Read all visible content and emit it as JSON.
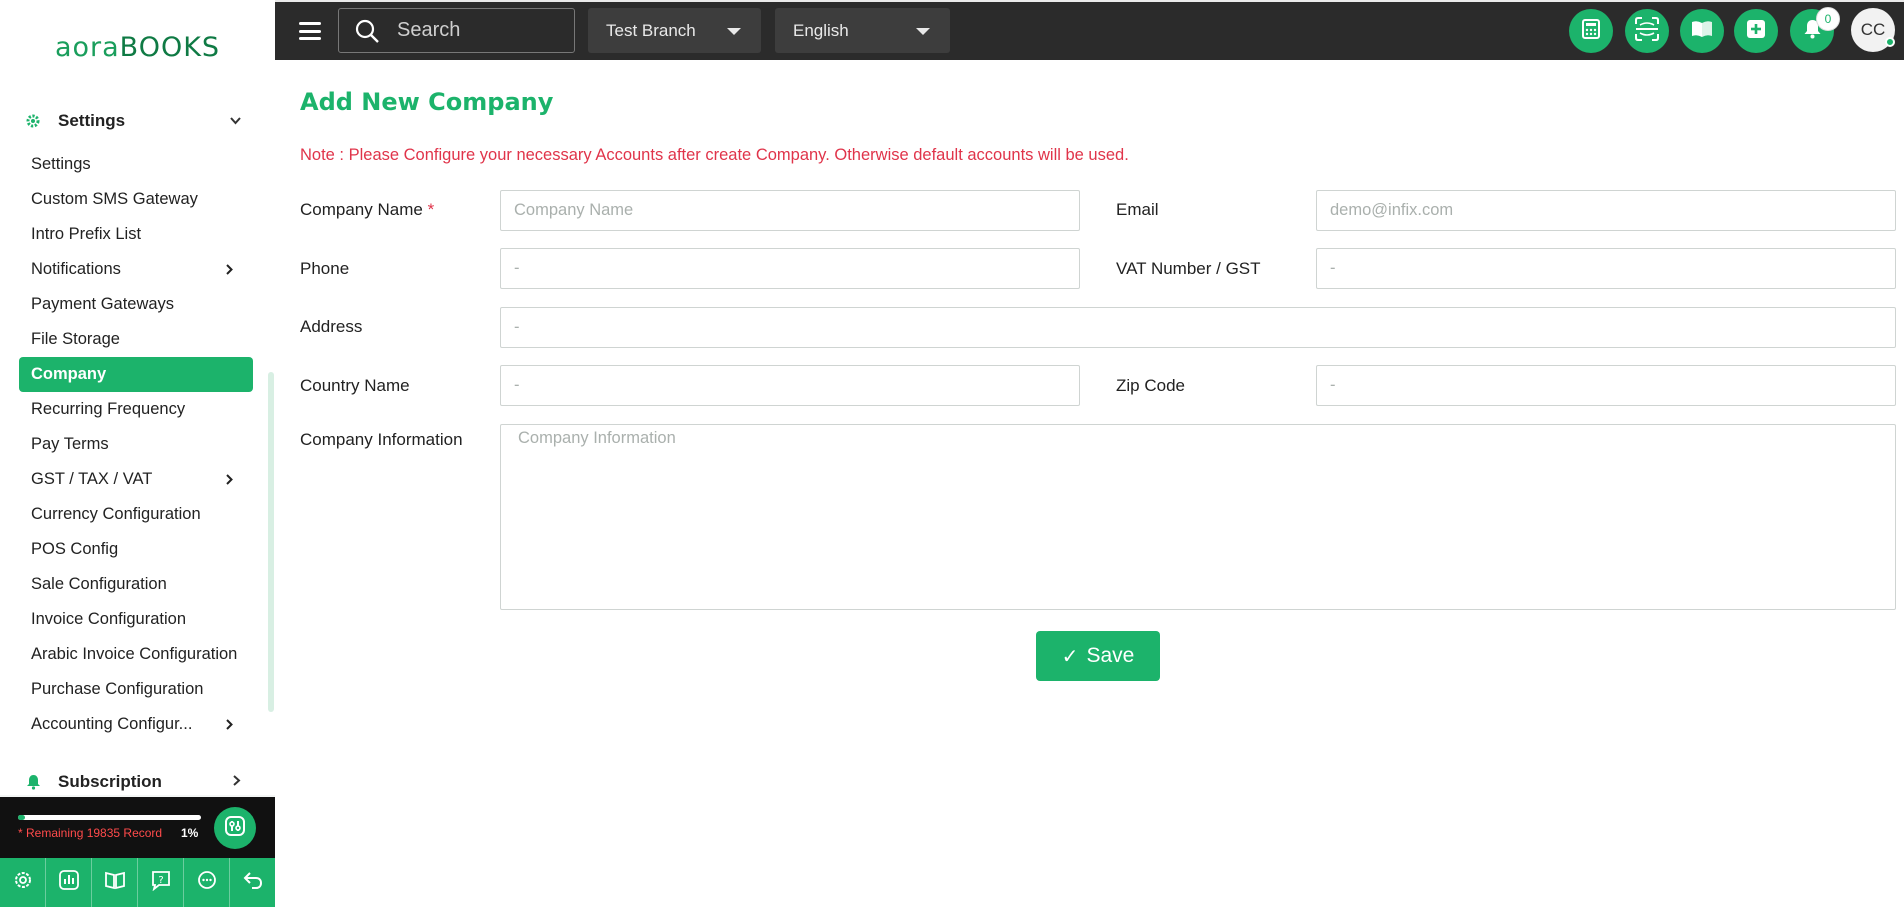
{
  "brand": {
    "logo_part1": "aora",
    "logo_part2": "BOOKS"
  },
  "header": {
    "search_placeholder": "Search",
    "branch": "Test Branch",
    "language": "English",
    "notification_count": "0",
    "avatar_initials": "CC",
    "buttons": [
      "calculator-icon",
      "scan-icon",
      "book-icon",
      "add-icon",
      "bell-icon"
    ]
  },
  "sidebar": {
    "section_title": "Settings",
    "items": [
      {
        "label": "Settings",
        "has_submenu": false,
        "active": false
      },
      {
        "label": "Custom SMS Gateway",
        "has_submenu": false,
        "active": false
      },
      {
        "label": "Intro Prefix List",
        "has_submenu": false,
        "active": false
      },
      {
        "label": "Notifications",
        "has_submenu": true,
        "active": false
      },
      {
        "label": "Payment Gateways",
        "has_submenu": false,
        "active": false
      },
      {
        "label": "File Storage",
        "has_submenu": false,
        "active": false
      },
      {
        "label": "Company",
        "has_submenu": false,
        "active": true
      },
      {
        "label": "Recurring Frequency",
        "has_submenu": false,
        "active": false
      },
      {
        "label": "Pay Terms",
        "has_submenu": false,
        "active": false
      },
      {
        "label": "GST / TAX / VAT",
        "has_submenu": true,
        "active": false
      },
      {
        "label": "Currency Configuration",
        "has_submenu": false,
        "active": false
      },
      {
        "label": "POS Config",
        "has_submenu": false,
        "active": false
      },
      {
        "label": "Sale Configuration",
        "has_submenu": false,
        "active": false
      },
      {
        "label": "Invoice Configuration",
        "has_submenu": false,
        "active": false
      },
      {
        "label": "Arabic Invoice Configuration",
        "has_submenu": false,
        "active": false
      },
      {
        "label": "Purchase Configuration",
        "has_submenu": false,
        "active": false
      },
      {
        "label": "Accounting Configur...",
        "has_submenu": true,
        "active": false
      }
    ],
    "next_section_title": "Subscription",
    "quota": {
      "text": "* Remaining 19835 Record",
      "percent": "1%",
      "fill": 0.01
    },
    "bottom_icons": [
      "settings-icon",
      "report-icon",
      "book-icon",
      "help-icon",
      "chat-icon",
      "back-icon"
    ]
  },
  "form": {
    "title": "Add New Company",
    "note": "Note : Please Configure your necessary Accounts after create Company. Otherwise default accounts will be used.",
    "company_name": {
      "label": "Company Name",
      "required_mark": "*",
      "placeholder": "Company Name"
    },
    "email": {
      "label": "Email",
      "placeholder": "demo@infix.com"
    },
    "phone": {
      "label": "Phone",
      "placeholder": "-"
    },
    "vat": {
      "label": "VAT Number / GST",
      "placeholder": "-"
    },
    "address": {
      "label": "Address",
      "placeholder": "-"
    },
    "country": {
      "label": "Country Name",
      "placeholder": "-"
    },
    "zip": {
      "label": "Zip Code",
      "placeholder": "-"
    },
    "info": {
      "label": "Company Information",
      "placeholder": "Company Information"
    },
    "save_check": "✓",
    "save_label": "Save"
  },
  "colors": {
    "accent": "#1cb36b",
    "header_bg": "#2b2b2b",
    "note_red": "#e0344a"
  }
}
